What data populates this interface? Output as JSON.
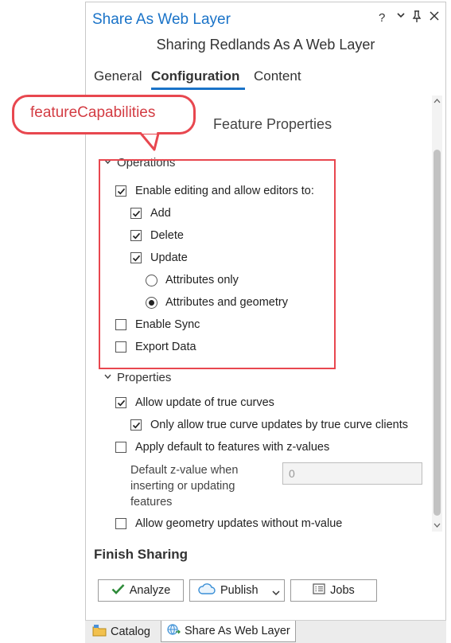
{
  "window": {
    "title": "Share As Web Layer",
    "controls": {
      "help": "?",
      "menu": "⌄",
      "pin": "📌",
      "close": "✕"
    },
    "subtitle": "Sharing Redlands As A Web Layer"
  },
  "tabs": [
    {
      "label": "General",
      "active": false
    },
    {
      "label": "Configuration",
      "active": true
    },
    {
      "label": "Content",
      "active": false
    }
  ],
  "section_title": "Feature Properties",
  "operations": {
    "title": "Operations",
    "enable_editing": {
      "label": "Enable editing and allow editors to:",
      "checked": true
    },
    "add": {
      "label": "Add",
      "checked": true
    },
    "delete": {
      "label": "Delete",
      "checked": true
    },
    "update": {
      "label": "Update",
      "checked": true
    },
    "attributes_only": {
      "label": "Attributes only",
      "selected": false
    },
    "attributes_geometry": {
      "label": "Attributes and geometry",
      "selected": true
    },
    "enable_sync": {
      "label": "Enable Sync",
      "checked": false
    },
    "export_data": {
      "label": "Export Data",
      "checked": false
    }
  },
  "properties": {
    "title": "Properties",
    "true_curves": {
      "label": "Allow update of true curves",
      "checked": true
    },
    "true_curve_clients": {
      "label": "Only allow true curve updates by true curve clients",
      "checked": true
    },
    "z_default": {
      "label": "Apply default to features with z-values",
      "checked": false
    },
    "z_value_label": [
      "Default z-value when",
      "inserting or updating",
      "features"
    ],
    "z_value": "0",
    "m_value": {
      "label": "Allow geometry updates without m-value",
      "checked": false
    }
  },
  "finish": {
    "title": "Finish Sharing",
    "analyze_label": "Analyze",
    "publish_label": "Publish",
    "jobs_label": "Jobs"
  },
  "bottom_tabs": [
    {
      "label": "Catalog",
      "active": false
    },
    {
      "label": "Share As Web Layer",
      "active": true
    }
  ],
  "callout": {
    "text": "featureCapabilities"
  },
  "colors": {
    "accent": "#1a73c8",
    "highlight": "#e8474f",
    "check_green": "#2e8b3a"
  }
}
